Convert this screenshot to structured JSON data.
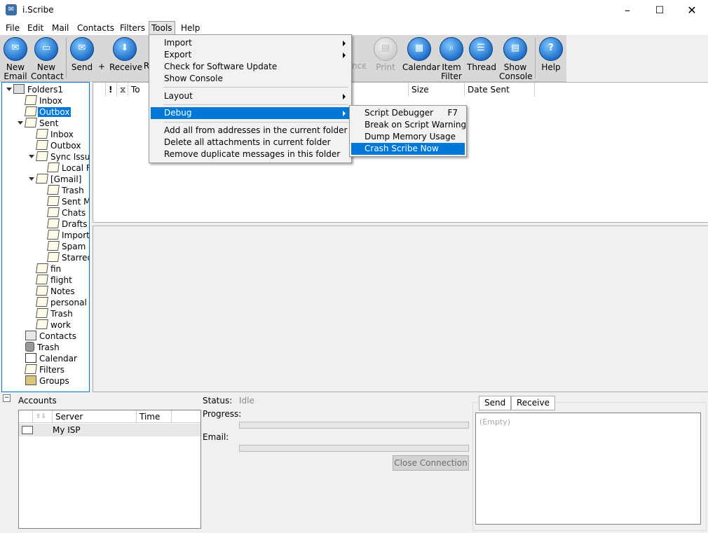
{
  "window": {
    "title": "i.Scribe",
    "minimize": "–",
    "maximize": "☐",
    "close": "✕"
  },
  "menubar": [
    "File",
    "Edit",
    "Mail",
    "Contacts",
    "Filters",
    "Tools",
    "Help"
  ],
  "toolbar": {
    "new_email": [
      "New",
      "Email"
    ],
    "new_contact": [
      "New",
      "Contact"
    ],
    "send": "Send",
    "plus": "+",
    "receive": "Receive",
    "partial_r": "R",
    "partial_nce": "nce",
    "print": "Print",
    "calendar": "Calendar",
    "item_filter": [
      "Item",
      "Filter"
    ],
    "thread": "Thread",
    "show_console": [
      "Show",
      "Console"
    ],
    "help": "Help"
  },
  "tree": {
    "root": "Folders1",
    "inbox": "Inbox",
    "outbox": "Outbox",
    "sent": "Sent",
    "sent_inbox": "Inbox",
    "sent_outbox": "Outbox",
    "sync_issues": "Sync Issue",
    "local": "Local F",
    "gmail": "[Gmail]",
    "g_trash": "Trash",
    "g_sent": "Sent M",
    "g_chats": "Chats",
    "g_drafts": "Drafts",
    "g_import": "Import",
    "g_spam": "Spam",
    "g_starred": "Starred",
    "fin": "fin",
    "flight": "flight",
    "notes": "Notes",
    "personal": "personal",
    "s_trash": "Trash",
    "work": "work",
    "contacts": "Contacts",
    "trash": "Trash",
    "calendar": "Calendar",
    "filters": "Filters",
    "groups": "Groups"
  },
  "msglist": {
    "col_flag": "!",
    "col_to": "To",
    "col_size": "Size",
    "col_date": "Date Sent"
  },
  "tools_menu": {
    "import": "Import",
    "export": "Export",
    "check_update": "Check for Software Update",
    "show_console": "Show Console",
    "layout": "Layout",
    "debug": "Debug",
    "add_all": "Add all from addresses in the current folder to...",
    "delete_attach": "Delete all attachments in current folder",
    "remove_dup": "Remove duplicate messages in this folder"
  },
  "debug_menu": {
    "script_debugger": "Script Debugger",
    "script_debugger_key": "F7",
    "break_warning": "Break on Script Warning",
    "dump_memory": "Dump Memory Usage",
    "crash": "Crash Scribe Now"
  },
  "accounts": {
    "title": "Accounts",
    "col_server": "Server",
    "col_time": "Time",
    "row_name": "My ISP"
  },
  "status": {
    "status_label": "Status:",
    "status_value": "Idle",
    "progress_label": "Progress:",
    "email_label": "Email:",
    "close_connection": "Close Connection"
  },
  "log": {
    "tab_send": "Send",
    "tab_receive": "Receive",
    "empty": "(Empty)"
  }
}
